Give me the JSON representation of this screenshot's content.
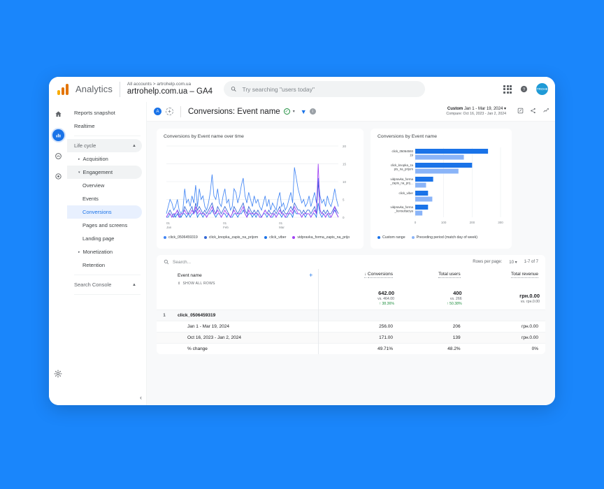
{
  "topbar": {
    "brand": "Analytics",
    "account_breadcrumb": "All accounts > artrohelp.com.ua",
    "property_name": "artrohelp.com.ua – GA4",
    "search_placeholder": "Try searching \"users today\"",
    "apps_icon": "apps-grid-icon",
    "help_icon": "help-icon",
    "avatar_initials": "ARTROHELP"
  },
  "rail": {
    "items": [
      {
        "name": "home-icon",
        "glyph": "⌂"
      },
      {
        "name": "reports-icon",
        "glyph": "▥"
      },
      {
        "name": "explore-icon",
        "glyph": "◔"
      },
      {
        "name": "advertising-icon",
        "glyph": "◎"
      }
    ],
    "settings_icon": "gear-icon"
  },
  "sidebar": {
    "items": [
      {
        "label": "Reports snapshot",
        "type": "item"
      },
      {
        "label": "Realtime",
        "type": "item"
      },
      {
        "label": "Life cycle",
        "type": "group",
        "expanded": true
      },
      {
        "label": "Acquisition",
        "type": "collapsed"
      },
      {
        "label": "Engagement",
        "type": "expanded"
      },
      {
        "label": "Overview",
        "type": "sub"
      },
      {
        "label": "Events",
        "type": "sub"
      },
      {
        "label": "Conversions",
        "type": "sub",
        "selected": true
      },
      {
        "label": "Pages and screens",
        "type": "sub"
      },
      {
        "label": "Landing page",
        "type": "sub"
      },
      {
        "label": "Monetization",
        "type": "collapsed"
      },
      {
        "label": "Retention",
        "type": "item2"
      },
      {
        "label": "Search Console",
        "type": "group",
        "expanded": true
      }
    ],
    "collapse_icon": "chevron-left-icon"
  },
  "report_header": {
    "audience_chip": "A",
    "add_comparison": "+",
    "title": "Conversions: Event name",
    "status_icon": "check-circle-icon",
    "filter_icon": "filter-icon",
    "info_icon": "info-icon",
    "date_label": "Custom",
    "date_range": "Jan 1 - Mar 19, 2024",
    "compare_text": "Compare: Oct 16, 2023 - Jan 2, 2024",
    "actions": [
      {
        "name": "edit-icon",
        "glyph": "🖉"
      },
      {
        "name": "share-icon",
        "glyph": "<"
      },
      {
        "name": "insights-icon",
        "glyph": "∿"
      }
    ]
  },
  "chart_data": [
    {
      "type": "line",
      "title": "Conversions by Event name over time",
      "xlabel": "",
      "ylabel": "",
      "ylim": [
        0,
        20
      ],
      "yticks": [
        0,
        5,
        10,
        15,
        20
      ],
      "xticks": [
        "01\nJan",
        "01\nFeb",
        "01\nMar"
      ],
      "grid": true,
      "legend_position": "bottom",
      "series": [
        {
          "name": "click_0506459319",
          "color": "#4285f4",
          "values": [
            1,
            3,
            5,
            4,
            2,
            3,
            5,
            2,
            1,
            2,
            8,
            4,
            5,
            3,
            6,
            4,
            9,
            3,
            8,
            5,
            6,
            3,
            2,
            4,
            7,
            12,
            6,
            5,
            8,
            4,
            3,
            6,
            8,
            4,
            5,
            2,
            3,
            8,
            7,
            4,
            6,
            9,
            11,
            6,
            4,
            7,
            5,
            3,
            6,
            4,
            5,
            3,
            2,
            4,
            6,
            3,
            5,
            2,
            4,
            3,
            2,
            5,
            7,
            3,
            4,
            2,
            3,
            5,
            7,
            4,
            14,
            11,
            8,
            6,
            4,
            5,
            3,
            4,
            6,
            3,
            5,
            7,
            4,
            11,
            6,
            4,
            5,
            3,
            6,
            4,
            3,
            5,
            8,
            5,
            3
          ]
        },
        {
          "name": "click_knopka_zapis_na_prijom",
          "color": "#3367d6",
          "values": [
            0,
            1,
            2,
            1,
            0,
            1,
            2,
            1,
            0,
            1,
            3,
            2,
            1,
            2,
            3,
            1,
            4,
            2,
            3,
            2,
            1,
            2,
            1,
            2,
            3,
            4,
            2,
            1,
            3,
            2,
            1,
            2,
            3,
            2,
            1,
            0,
            1,
            3,
            2,
            1,
            2,
            3,
            4,
            2,
            1,
            3,
            2,
            1,
            2,
            1,
            2,
            1,
            0,
            1,
            2,
            1,
            2,
            1,
            1,
            2,
            1,
            2,
            3,
            1,
            2,
            1,
            1,
            2,
            3,
            2,
            4,
            3,
            2,
            2,
            1,
            2,
            1,
            2,
            2,
            1,
            2,
            3,
            1,
            10,
            2,
            1,
            2,
            1,
            2,
            1,
            1,
            2,
            3,
            2,
            1
          ]
        },
        {
          "name": "click_viber",
          "color": "#1a73e8",
          "values": [
            0,
            0,
            1,
            0,
            1,
            0,
            1,
            0,
            0,
            1,
            1,
            0,
            1,
            0,
            1,
            1,
            2,
            0,
            1,
            1,
            0,
            1,
            0,
            1,
            1,
            2,
            1,
            0,
            1,
            1,
            0,
            1,
            1,
            0,
            1,
            0,
            0,
            1,
            1,
            0,
            1,
            1,
            2,
            1,
            0,
            1,
            1,
            0,
            1,
            0,
            1,
            0,
            0,
            1,
            1,
            0,
            1,
            0,
            0,
            1,
            0,
            1,
            1,
            0,
            1,
            0,
            0,
            1,
            1,
            0,
            2,
            1,
            1,
            1,
            0,
            1,
            0,
            1,
            1,
            0,
            1,
            1,
            0,
            4,
            1,
            0,
            1,
            0,
            1,
            0,
            0,
            1,
            2,
            1,
            0
          ]
        },
        {
          "name": "vidpravka_forma_zapis_na_prijo",
          "color": "#a142f4",
          "values": [
            0,
            1,
            1,
            0,
            1,
            1,
            2,
            0,
            1,
            1,
            2,
            1,
            1,
            1,
            2,
            1,
            3,
            1,
            2,
            1,
            1,
            1,
            0,
            1,
            2,
            3,
            1,
            1,
            2,
            1,
            0,
            1,
            2,
            1,
            1,
            0,
            1,
            2,
            1,
            1,
            1,
            2,
            3,
            1,
            0,
            2,
            1,
            1,
            1,
            1,
            1,
            0,
            0,
            1,
            2,
            1,
            1,
            0,
            1,
            1,
            0,
            1,
            2,
            1,
            1,
            0,
            1,
            1,
            2,
            1,
            3,
            2,
            1,
            1,
            0,
            1,
            1,
            1,
            1,
            0,
            1,
            2,
            1,
            15,
            2,
            1,
            1,
            0,
            1,
            1,
            0,
            1,
            3,
            1,
            0
          ]
        }
      ],
      "legend": [
        {
          "label": "click_0506459319",
          "color": "#4285f4"
        },
        {
          "label": "click_knopka_zapis_na_prijom",
          "color": "#3367d6"
        },
        {
          "label": "click_viber",
          "color": "#1a73e8"
        },
        {
          "label": "vidpravka_forma_zapis_na_prijo",
          "color": "#a142f4"
        }
      ]
    },
    {
      "type": "bar",
      "title": "Conversions by Event name",
      "orientation": "horizontal",
      "xlim": [
        0,
        300
      ],
      "xticks": [
        0,
        100,
        200,
        300
      ],
      "categories": [
        "click_05064593\n19",
        "click_knopka_za\npis_na_prijom",
        "vidpravka_forma\n_zapis_na_prij…",
        "click_viber",
        "vidpravka_forma\n_konsultaciya"
      ],
      "series": [
        {
          "name": "Custom range",
          "color": "#1a73e8",
          "values": [
            256,
            200,
            63,
            45,
            45
          ]
        },
        {
          "name": "Preceding period (match day of week)",
          "color": "#8ab4f8",
          "values": [
            171,
            152,
            38,
            60,
            25
          ]
        }
      ],
      "legend": [
        {
          "label": "Custom range",
          "color": "#1a73e8"
        },
        {
          "label": "Preceding period (match day of week)",
          "color": "#8ab4f8"
        }
      ]
    }
  ],
  "table": {
    "search_placeholder": "Search...",
    "rows_per_page_label": "Rows per page:",
    "rows_per_page_value": "10",
    "range_label": "1-7 of 7",
    "dimension_header": "Event name",
    "add_dimension": "+",
    "show_all_rows": "SHOW ALL ROWS",
    "metric_headers": [
      "Conversions",
      "Total users",
      "Total revenue"
    ],
    "sort_indicator": "↓",
    "totals": [
      {
        "value": "642.00",
        "compare": "vs. 464.00",
        "change": "38.36%",
        "change_dir": "up"
      },
      {
        "value": "400",
        "compare": "vs. 266",
        "change": "50.38%",
        "change_dir": "up"
      },
      {
        "value": "грн.0.00",
        "compare": "vs. грн.0.00",
        "change": "",
        "change_dir": ""
      }
    ],
    "rows": [
      {
        "index": "1",
        "name": "click_0506459319",
        "detail": [
          {
            "label": "Jan 1 - Mar 19, 2024",
            "values": [
              "256.00",
              "206",
              "грн.0.00"
            ]
          },
          {
            "label": "Oct 16, 2023 - Jan 2, 2024",
            "values": [
              "171.00",
              "139",
              "грн.0.00"
            ]
          },
          {
            "label": "% change",
            "values": [
              "49.71%",
              "48.2%",
              "0%"
            ]
          }
        ]
      }
    ]
  },
  "colors": {
    "page_background": "#1a86fb",
    "accent": "#1a73e8",
    "positive": "#1e8e3e",
    "surface": "#ffffff",
    "canvas": "#f8f9fa"
  }
}
